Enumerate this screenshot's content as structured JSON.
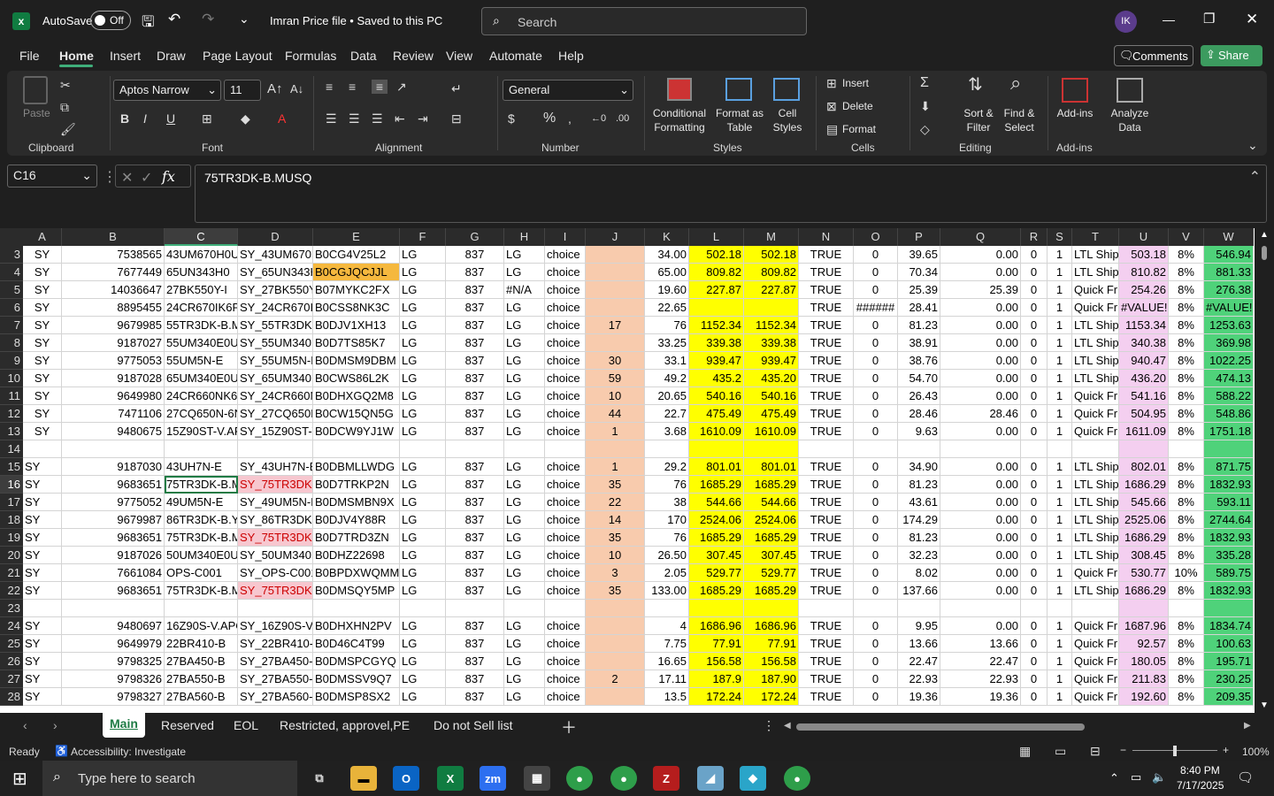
{
  "titlebar": {
    "autosave": "AutoSave",
    "toggle": "Off",
    "filename": "Imran Price file • Saved to this PC",
    "search_placeholder": "Search",
    "avatar": "IK"
  },
  "menu": [
    "File",
    "Home",
    "Insert",
    "Draw",
    "Page Layout",
    "Formulas",
    "Data",
    "Review",
    "View",
    "Automate",
    "Help"
  ],
  "menu_right": {
    "comments": "Comments",
    "share": "Share"
  },
  "ribbon": {
    "clipboard": {
      "label": "Clipboard",
      "paste": "Paste"
    },
    "font": {
      "label": "Font",
      "name": "Aptos Narrow",
      "size": "11"
    },
    "alignment": {
      "label": "Alignment"
    },
    "number": {
      "label": "Number",
      "format": "General"
    },
    "styles": {
      "label": "Styles",
      "cond": "Conditional",
      "cond2": "Formatting",
      "fmt": "Format as",
      "fmt2": "Table",
      "cell": "Cell",
      "cell2": "Styles"
    },
    "cells": {
      "label": "Cells",
      "insert": "Insert",
      "delete": "Delete",
      "format": "Format"
    },
    "editing": {
      "label": "Editing",
      "sort": "Sort &",
      "sort2": "Filter",
      "find": "Find &",
      "find2": "Select"
    },
    "addins": {
      "label": "Add-ins",
      "addins": "Add-ins",
      "analyze": "Analyze",
      "analyze2": "Data"
    }
  },
  "formula": {
    "namebox": "C16",
    "fx": "fx",
    "content": "75TR3DK-B.MUSQ"
  },
  "columns": [
    "A",
    "B",
    "C",
    "D",
    "E",
    "F",
    "G",
    "H",
    "I",
    "J",
    "K",
    "L",
    "M",
    "N",
    "O",
    "P",
    "Q",
    "R",
    "S",
    "T",
    "U",
    "V",
    "W"
  ],
  "rows": [
    {
      "n": "3",
      "c": [
        "SY",
        "7538565",
        "43UM670H0U",
        "SY_43UM670H",
        "B0CG4V25L2",
        "LG",
        "837",
        "LG",
        "choice",
        "",
        "34.00",
        "502.18",
        "502.18",
        "TRUE",
        "0",
        "39.65",
        "0.00",
        "0",
        "1",
        "LTL Ship",
        "503.18",
        "8%",
        "546.94"
      ]
    },
    {
      "n": "4",
      "c": [
        "SY",
        "7677449",
        "65UN343H0",
        "SY_65UN343H",
        "B0CGJQCJJL",
        "LG",
        "837",
        "LG",
        "choice",
        "",
        "65.00",
        "809.82",
        "809.82",
        "TRUE",
        "0",
        "70.34",
        "0.00",
        "0",
        "1",
        "LTL Ship",
        "810.82",
        "8%",
        "881.33"
      ]
    },
    {
      "n": "5",
      "c": [
        "SY",
        "14036647",
        "27BK550Y-I",
        "SY_27BK550Y-",
        "B07MYKC2FX",
        "LG",
        "837",
        "#N/A",
        "choice",
        "",
        "19.60",
        "227.87",
        "227.87",
        "TRUE",
        "0",
        "25.39",
        "25.39",
        "0",
        "1",
        "Quick Fr",
        "254.26",
        "8%",
        "276.38"
      ]
    },
    {
      "n": "6",
      "c": [
        "SY",
        "8895455",
        "24CR670IK6P",
        "SY_24CR670IK",
        "B0CSS8NK3C",
        "LG",
        "837",
        "LG",
        "choice",
        "",
        "22.65",
        "",
        "",
        "TRUE",
        "######",
        "28.41",
        "0.00",
        "0",
        "1",
        "Quick Fr",
        "#VALUE!",
        "8%",
        "#VALUE!"
      ]
    },
    {
      "n": "7",
      "c": [
        "SY",
        "9679985",
        "55TR3DK-B.M",
        "SY_55TR3DK-",
        "B0DJV1XH13",
        "LG",
        "837",
        "LG",
        "choice",
        "17",
        "76",
        "1152.34",
        "1152.34",
        "TRUE",
        "0",
        "81.23",
        "0.00",
        "0",
        "1",
        "LTL Ship",
        "1153.34",
        "8%",
        "1253.63"
      ]
    },
    {
      "n": "8",
      "c": [
        "SY",
        "9187027",
        "55UM340E0U",
        "SY_55UM340E",
        "B0D7TS85K7",
        "LG",
        "837",
        "LG",
        "choice",
        "",
        "33.25",
        "339.38",
        "339.38",
        "TRUE",
        "0",
        "38.91",
        "0.00",
        "0",
        "1",
        "LTL Ship",
        "340.38",
        "8%",
        "369.98"
      ]
    },
    {
      "n": "9",
      "c": [
        "SY",
        "9775053",
        "55UM5N-E",
        "SY_55UM5N-E",
        "B0DMSM9DBM",
        "LG",
        "837",
        "LG",
        "choice",
        "30",
        "33.1",
        "939.47",
        "939.47",
        "TRUE",
        "0",
        "38.76",
        "0.00",
        "0",
        "1",
        "LTL Ship",
        "940.47",
        "8%",
        "1022.25"
      ]
    },
    {
      "n": "10",
      "c": [
        "SY",
        "9187028",
        "65UM340E0U",
        "SY_65UM340E",
        "B0CWS86L2K",
        "LG",
        "837",
        "LG",
        "choice",
        "59",
        "49.2",
        "435.2",
        "435.20",
        "TRUE",
        "0",
        "54.70",
        "0.00",
        "0",
        "1",
        "LTL Ship",
        "436.20",
        "8%",
        "474.13"
      ]
    },
    {
      "n": "11",
      "c": [
        "SY",
        "9649980",
        "24CR660NK6I",
        "SY_24CR660N",
        "B0DHXGQ2M8",
        "LG",
        "837",
        "LG",
        "choice",
        "10",
        "20.65",
        "540.16",
        "540.16",
        "TRUE",
        "0",
        "26.43",
        "0.00",
        "0",
        "1",
        "Quick Fr",
        "541.16",
        "8%",
        "588.22"
      ]
    },
    {
      "n": "12",
      "c": [
        "SY",
        "7471106",
        "27CQ650N-6N",
        "SY_27CQ650N",
        "B0CW15QN5G",
        "LG",
        "837",
        "LG",
        "choice",
        "44",
        "22.7",
        "475.49",
        "475.49",
        "TRUE",
        "0",
        "28.46",
        "28.46",
        "0",
        "1",
        "Quick Fr",
        "504.95",
        "8%",
        "548.86"
      ]
    },
    {
      "n": "13",
      "c": [
        "SY",
        "9480675",
        "15Z90ST-V.AP",
        "SY_15Z90ST-V",
        "B0DCW9YJ1W",
        "LG",
        "837",
        "LG",
        "choice",
        "1",
        "3.68",
        "1610.09",
        "1610.09",
        "TRUE",
        "0",
        "9.63",
        "0.00",
        "0",
        "1",
        "Quick Fr",
        "1611.09",
        "8%",
        "1751.18"
      ]
    },
    {
      "n": "14",
      "c": [
        "",
        "",
        "",
        "",
        "",
        "",
        "",
        "",
        "",
        "",
        "",
        "",
        "",
        "",
        "",
        "",
        "",
        "",
        "",
        "",
        "",
        "",
        ""
      ]
    },
    {
      "n": "15",
      "c": [
        "SY",
        "9187030",
        "43UH7N-E",
        "SY_43UH7N-E",
        "B0DBMLLWDG",
        "LG",
        "837",
        "LG",
        "choice",
        "1",
        "29.2",
        "801.01",
        "801.01",
        "TRUE",
        "0",
        "34.90",
        "0.00",
        "0",
        "1",
        "LTL Ship",
        "802.01",
        "8%",
        "871.75"
      ]
    },
    {
      "n": "16",
      "c": [
        "SY",
        "9683651",
        "75TR3DK-B.M",
        "SY_75TR3DK-B",
        "B0D7TRKP2N",
        "LG",
        "837",
        "LG",
        "choice",
        "35",
        "76",
        "1685.29",
        "1685.29",
        "TRUE",
        "0",
        "81.23",
        "0.00",
        "0",
        "1",
        "LTL Ship",
        "1686.29",
        "8%",
        "1832.93"
      ]
    },
    {
      "n": "17",
      "c": [
        "SY",
        "9775052",
        "49UM5N-E",
        "SY_49UM5N-E",
        "B0DMSMBN9X",
        "LG",
        "837",
        "LG",
        "choice",
        "22",
        "38",
        "544.66",
        "544.66",
        "TRUE",
        "0",
        "43.61",
        "0.00",
        "0",
        "1",
        "LTL Ship",
        "545.66",
        "8%",
        "593.11"
      ]
    },
    {
      "n": "18",
      "c": [
        "SY",
        "9679987",
        "86TR3DK-B.YI",
        "SY_86TR3DK-",
        "B0DJV4Y88R",
        "LG",
        "837",
        "LG",
        "choice",
        "14",
        "170",
        "2524.06",
        "2524.06",
        "TRUE",
        "0",
        "174.29",
        "0.00",
        "0",
        "1",
        "LTL Ship",
        "2525.06",
        "8%",
        "2744.64"
      ]
    },
    {
      "n": "19",
      "c": [
        "SY",
        "9683651",
        "75TR3DK-B.M",
        "SY_75TR3DK-B",
        "B0D7TRD3ZN",
        "LG",
        "837",
        "LG",
        "choice",
        "35",
        "76",
        "1685.29",
        "1685.29",
        "TRUE",
        "0",
        "81.23",
        "0.00",
        "0",
        "1",
        "LTL Ship",
        "1686.29",
        "8%",
        "1832.93"
      ]
    },
    {
      "n": "20",
      "c": [
        "SY",
        "9187026",
        "50UM340E0U",
        "SY_50UM340E",
        "B0DHZ22698",
        "LG",
        "837",
        "LG",
        "choice",
        "10",
        "26.50",
        "307.45",
        "307.45",
        "TRUE",
        "0",
        "32.23",
        "0.00",
        "0",
        "1",
        "LTL Ship",
        "308.45",
        "8%",
        "335.28"
      ]
    },
    {
      "n": "21",
      "c": [
        "SY",
        "7661084",
        "OPS-C001",
        "SY_OPS-C001",
        "B0BPDXWQMM",
        "LG",
        "837",
        "LG",
        "choice",
        "3",
        "2.05",
        "529.77",
        "529.77",
        "TRUE",
        "0",
        "8.02",
        "0.00",
        "0",
        "1",
        "Quick Fr",
        "530.77",
        "10%",
        "589.75"
      ]
    },
    {
      "n": "22",
      "c": [
        "SY",
        "9683651",
        "75TR3DK-B.M",
        "SY_75TR3DK-B",
        "B0DMSQY5MP",
        "LG",
        "837",
        "LG",
        "choice",
        "35",
        "133.00",
        "1685.29",
        "1685.29",
        "TRUE",
        "0",
        "137.66",
        "0.00",
        "0",
        "1",
        "LTL Ship",
        "1686.29",
        "8%",
        "1832.93"
      ]
    },
    {
      "n": "23",
      "c": [
        "",
        "",
        "",
        "",
        "",
        "",
        "",
        "",
        "",
        "",
        "",
        "",
        "",
        "",
        "",
        "",
        "",
        "",
        "",
        "",
        "",
        "",
        ""
      ]
    },
    {
      "n": "24",
      "c": [
        "SY",
        "9480697",
        "16Z90S-V.APC",
        "SY_16Z90S-V.",
        "B0DHXHN2PV",
        "LG",
        "837",
        "LG",
        "choice",
        "",
        "4",
        "1686.96",
        "1686.96",
        "TRUE",
        "0",
        "9.95",
        "0.00",
        "0",
        "1",
        "Quick Fr",
        "1687.96",
        "8%",
        "1834.74"
      ]
    },
    {
      "n": "25",
      "c": [
        "SY",
        "9649979",
        "22BR410-B",
        "SY_22BR410-E",
        "B0D46C4T99",
        "LG",
        "837",
        "LG",
        "choice",
        "",
        "7.75",
        "77.91",
        "77.91",
        "TRUE",
        "0",
        "13.66",
        "13.66",
        "0",
        "1",
        "Quick Fr",
        "92.57",
        "8%",
        "100.63"
      ]
    },
    {
      "n": "26",
      "c": [
        "SY",
        "9798325",
        "27BA450-B",
        "SY_27BA450-E",
        "B0DMSPCGYQ",
        "LG",
        "837",
        "LG",
        "choice",
        "",
        "16.65",
        "156.58",
        "156.58",
        "TRUE",
        "0",
        "22.47",
        "22.47",
        "0",
        "1",
        "Quick Fr",
        "180.05",
        "8%",
        "195.71"
      ]
    },
    {
      "n": "27",
      "c": [
        "SY",
        "9798326",
        "27BA550-B",
        "SY_27BA550-E",
        "B0DMSSV9Q7",
        "LG",
        "837",
        "LG",
        "choice",
        "2",
        "17.11",
        "187.9",
        "187.90",
        "TRUE",
        "0",
        "22.93",
        "22.93",
        "0",
        "1",
        "Quick Fr",
        "211.83",
        "8%",
        "230.25"
      ]
    },
    {
      "n": "28",
      "c": [
        "SY",
        "9798327",
        "27BA560-B",
        "SY_27BA560-E",
        "B0DMSP8SX2",
        "LG",
        "837",
        "LG",
        "choice",
        "",
        "13.5",
        "172.24",
        "172.24",
        "TRUE",
        "0",
        "19.36",
        "19.36",
        "0",
        "1",
        "Quick Fr",
        "192.60",
        "8%",
        "209.35"
      ]
    }
  ],
  "sheets": [
    "Main",
    "Reserved",
    "EOL",
    "Restricted, approvel,PE",
    "Do not Sell list"
  ],
  "status": {
    "ready": "Ready",
    "accessibility": "Accessibility: Investigate",
    "zoom": "100%"
  },
  "taskbar": {
    "search": "Type here to search",
    "time": "8:40 PM",
    "date": "7/17/2025"
  }
}
